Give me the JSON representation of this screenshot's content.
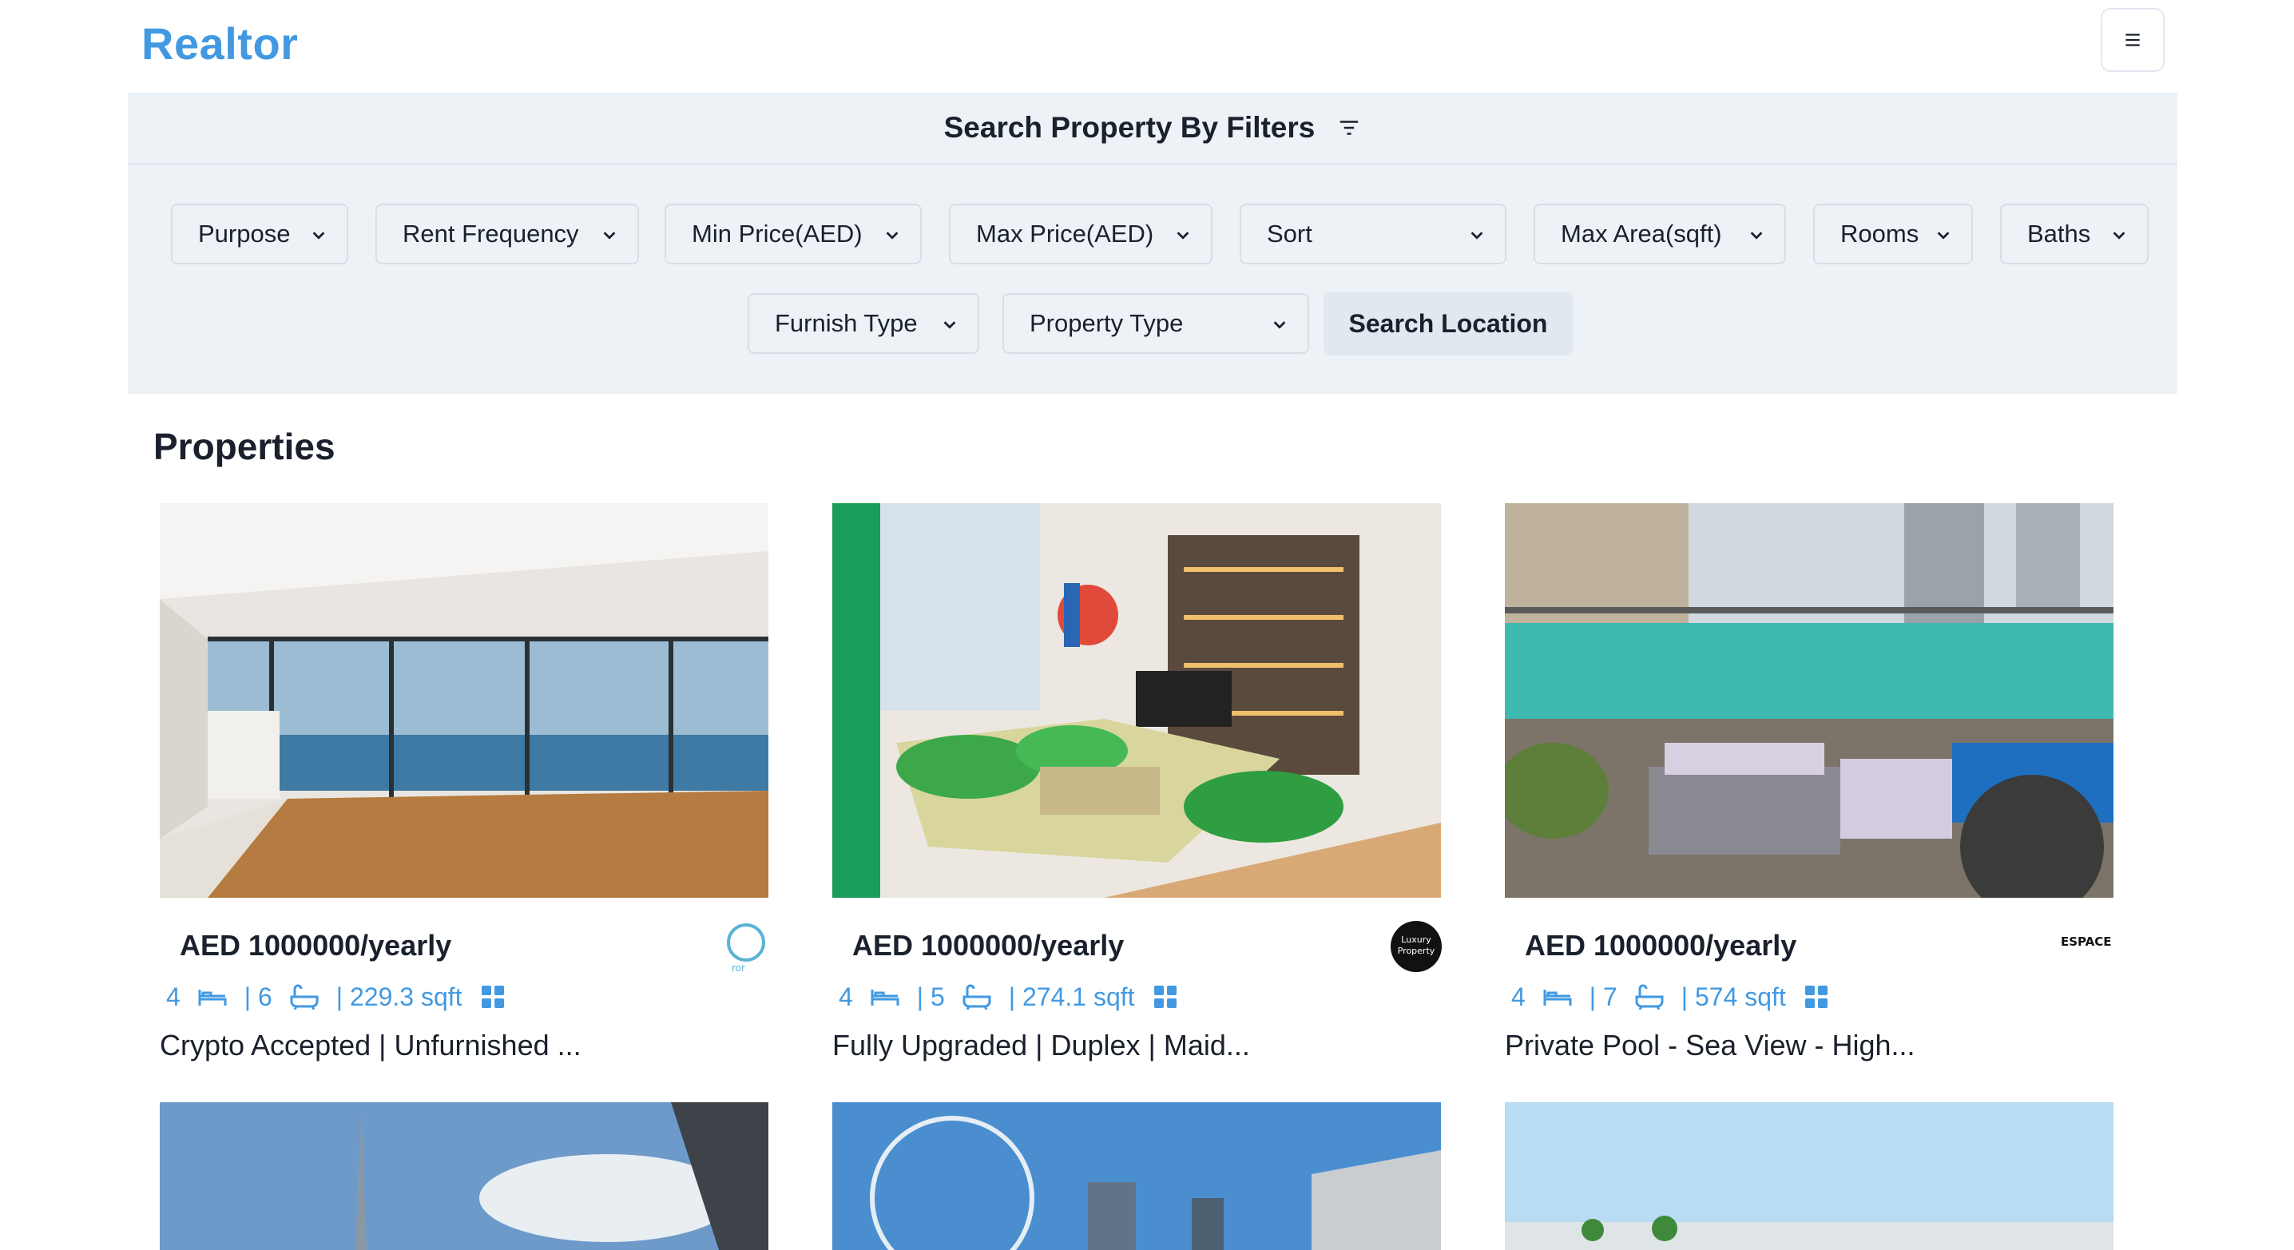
{
  "header": {
    "brand": "Realtor"
  },
  "filters": {
    "title": "Search Property By Filters",
    "selects": [
      {
        "label": "Purpose"
      },
      {
        "label": "Rent Frequency"
      },
      {
        "label": "Min Price(AED)"
      },
      {
        "label": "Max Price(AED)"
      },
      {
        "label": "Sort"
      },
      {
        "label": "Max Area(sqft)"
      },
      {
        "label": "Rooms"
      },
      {
        "label": "Baths"
      },
      {
        "label": "Furnish Type"
      },
      {
        "label": "Property Type"
      }
    ],
    "search_location_label": "Search Location"
  },
  "section_title": "Properties",
  "properties": [
    {
      "price": "AED 1000000/yearly",
      "rooms": "4",
      "baths": "| 6",
      "area": "| 229.3 sqft",
      "title": "Crypto Accepted | Unfurnished ...",
      "agency_logo": "ror"
    },
    {
      "price": "AED 1000000/yearly",
      "rooms": "4",
      "baths": "| 5",
      "area": "| 274.1 sqft",
      "title": "Fully Upgraded | Duplex | Maid...",
      "agency_logo": "Luxury Property"
    },
    {
      "price": "AED 1000000/yearly",
      "rooms": "4",
      "baths": "| 7",
      "area": "| 574 sqft",
      "title": "Private Pool - Sea View - High...",
      "agency_logo": "ESPACE"
    }
  ],
  "colors": {
    "brand": "#4299e1",
    "panel": "#edf2f7",
    "text": "#1a202c"
  }
}
